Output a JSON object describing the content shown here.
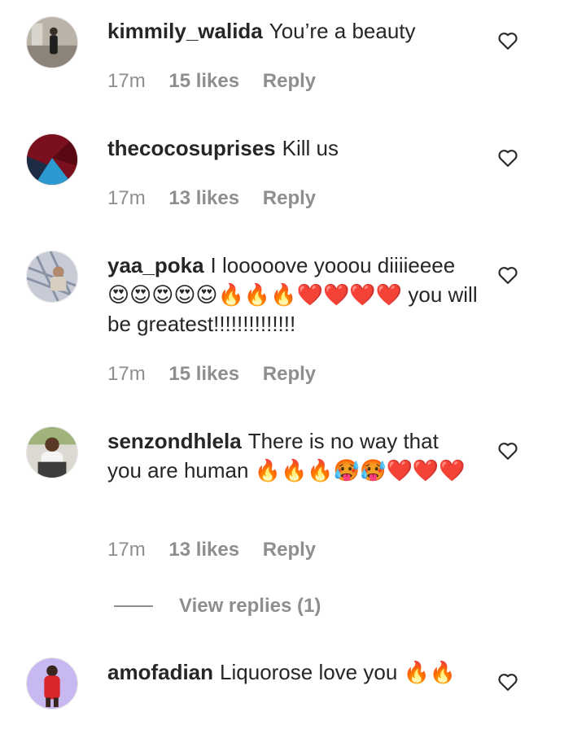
{
  "comments": [
    {
      "username": "kimmily_walida",
      "text": "You’re a beauty",
      "time": "17m",
      "likes": "15 likes",
      "reply": "Reply"
    },
    {
      "username": "thecocosuprises",
      "text": "Kill us",
      "time": "17m",
      "likes": "13 likes",
      "reply": "Reply"
    },
    {
      "username": "yaa_poka",
      "text": "I looooove yooou diiiieeee 😍😍😍😍😍🔥🔥🔥❤️❤️❤️❤️ you will be greatest!!!!!!!!!!!!!!",
      "time": "17m",
      "likes": "15 likes",
      "reply": "Reply"
    },
    {
      "username": "senzondhlela",
      "text": "There is no way that you are human 🔥🔥🔥🥵🥵❤️❤️❤️",
      "time": "17m",
      "likes": "13 likes",
      "reply": "Reply"
    },
    {
      "username": "amofadian",
      "text": "Liquorose love you 🔥🔥"
    }
  ],
  "view_replies": "View replies (1)",
  "icons": {
    "like": "heart-outline-icon"
  }
}
